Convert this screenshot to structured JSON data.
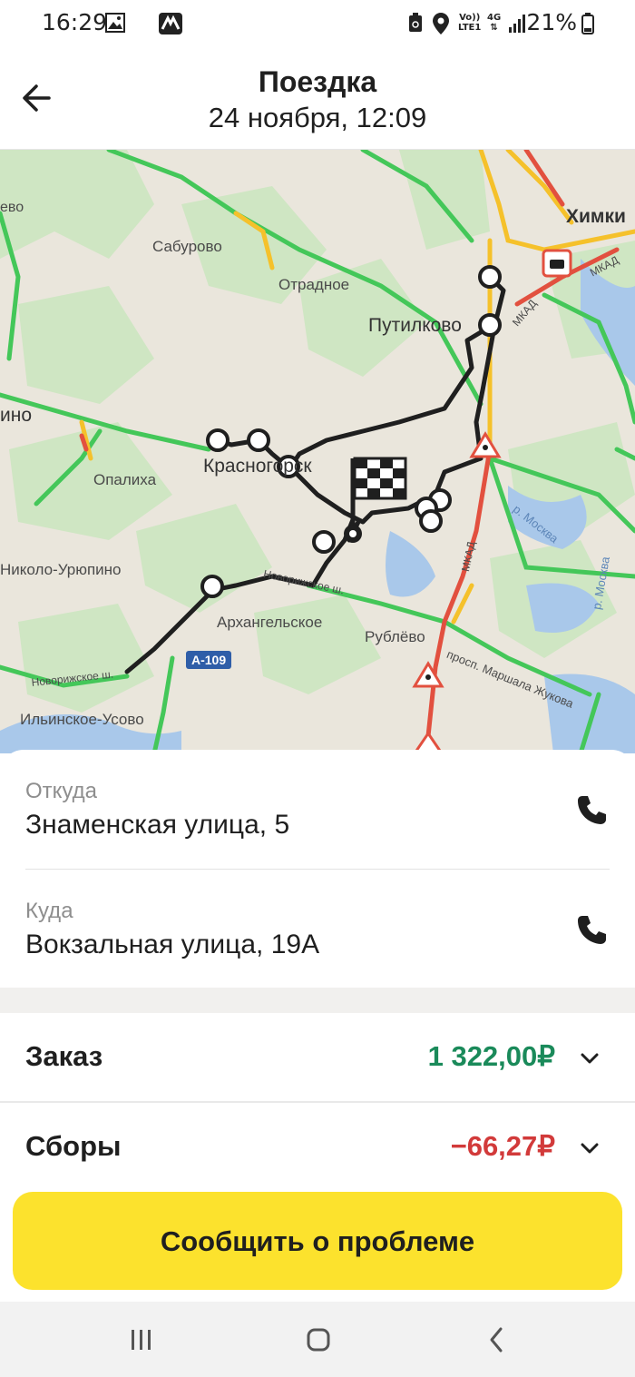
{
  "status_bar": {
    "time": "16:29",
    "battery": "21%",
    "volte_top": "Vo))",
    "volte_bottom": "LTE1",
    "network": "4G",
    "icons": [
      "image-icon",
      "app-icon",
      "recycle-icon",
      "location-icon",
      "signal-icon",
      "battery-icon"
    ]
  },
  "header": {
    "title": "Поездка",
    "subtitle": "24 ноября, 12:09",
    "back_icon": "arrow-left-icon"
  },
  "map": {
    "labels": {
      "khimki": "Химки",
      "saburovo": "Сабурово",
      "otradnoe": "Отрадное",
      "putilkovo": "Путилково",
      "krasnogorsk": "Красногорск",
      "opalikha": "Опалиха",
      "nikolo_uryupino": "Николо-Урюпино",
      "arkhangelskoe": "Архангельское",
      "rublevo": "Рублёво",
      "ilinskoe_usovo": "Ильинское-Усово",
      "novorizhskoe_1": "Новорижское ш.",
      "novorizhskoe_2": "Новорижское ш.",
      "marshala_zhukova": "просп. Маршала Жукова",
      "mkad_1": "МКАД",
      "mkad_2": "МКАД",
      "mkad_3": "МКАД",
      "moskva_1": "р. Москва",
      "moskva_2": "р. Москва",
      "edge_left_1": "ево",
      "edge_left_2": "ино",
      "highway": "А-109"
    },
    "colors": {
      "land": "#eae6dc",
      "forest": "#cfe6c3",
      "water": "#a9c8ea",
      "traffic_green": "#44c759",
      "traffic_yellow": "#f5c12b",
      "traffic_red": "#e2503f",
      "route": "#1f1f1f"
    }
  },
  "trip": {
    "from_label": "Откуда",
    "from_value": "Знаменская улица, 5",
    "to_label": "Куда",
    "to_value": "Вокзальная улица, 19А",
    "phone_icon": "phone-icon"
  },
  "summary": {
    "order_label": "Заказ",
    "order_value": "1 322,00₽",
    "order_color": "#1a8a5a",
    "fees_label": "Сборы",
    "fees_value": "−66,27₽",
    "fees_color": "#d23a3a",
    "chevron_icon": "chevron-down-icon"
  },
  "actions": {
    "report_label": "Сообщить о проблеме",
    "report_color": "#fce22d"
  },
  "nav_bar": {
    "icons": [
      "recents-icon",
      "home-icon",
      "back-icon"
    ]
  }
}
